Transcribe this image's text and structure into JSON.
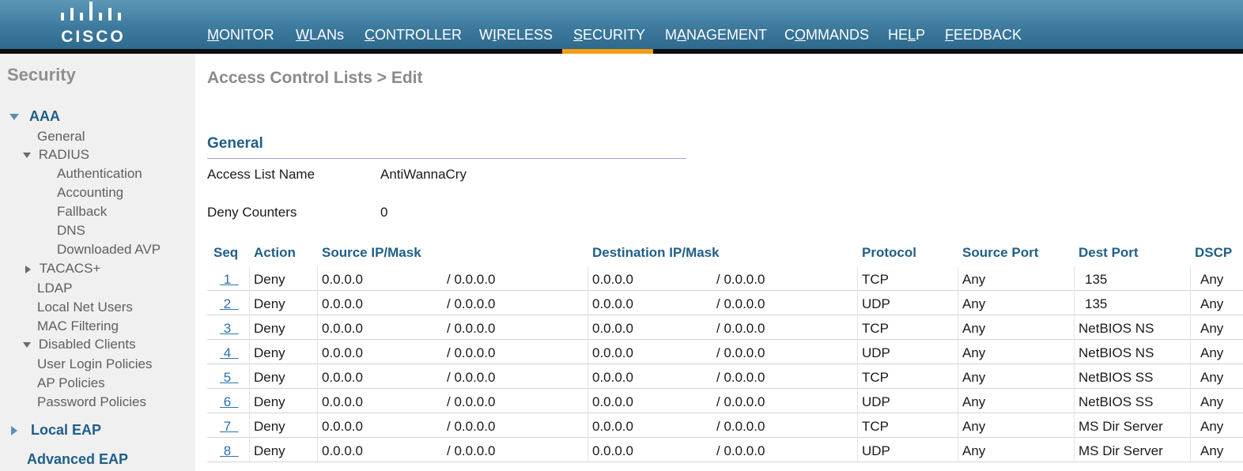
{
  "logo": {
    "text": "CISCO"
  },
  "nav": [
    {
      "label": "MONITOR",
      "u": "M",
      "rest": "ONITOR"
    },
    {
      "label": "WLANs",
      "u": "W",
      "rest": "LANs"
    },
    {
      "label": "CONTROLLER",
      "u": "C",
      "rest": "ONTROLLER"
    },
    {
      "label": "WIRELESS",
      "pre": "W",
      "u": "I",
      "rest": "RELESS"
    },
    {
      "label": "SECURITY",
      "u": "S",
      "rest": "ECURITY",
      "active": true
    },
    {
      "label": "MANAGEMENT",
      "pre": "M",
      "u": "A",
      "rest": "NAGEMENT"
    },
    {
      "label": "COMMANDS",
      "pre": "C",
      "u": "O",
      "rest": "MMANDS"
    },
    {
      "label": "HELP",
      "pre": "HE",
      "u": "L",
      "rest": "P"
    },
    {
      "label": "FEEDBACK",
      "u": "F",
      "rest": "EEDBACK"
    }
  ],
  "sidebar": {
    "title": "Security",
    "aaa": "AAA",
    "general": "General",
    "radius": "RADIUS",
    "authentication": "Authentication",
    "accounting": "Accounting",
    "fallback": "Fallback",
    "dns": "DNS",
    "downloaded_avp": "Downloaded AVP",
    "tacacs": "TACACS+",
    "ldap": "LDAP",
    "local_net_users": "Local Net Users",
    "mac_filtering": "MAC Filtering",
    "disabled_clients": "Disabled Clients",
    "user_login_policies": "User Login Policies",
    "ap_policies": "AP Policies",
    "password_policies": "Password Policies",
    "local_eap": "Local EAP",
    "advanced_eap": "Advanced EAP"
  },
  "page": {
    "title": "Access Control Lists > Edit",
    "section": "General",
    "access_list_name_label": "Access List Name",
    "access_list_name": "AntiWannaCry",
    "deny_counters_label": "Deny Counters",
    "deny_counters": "0"
  },
  "table": {
    "headers": {
      "seq": "Seq",
      "action": "Action",
      "source": "Source IP/Mask",
      "destination": "Destination IP/Mask",
      "protocol": "Protocol",
      "source_port": "Source Port",
      "dest_port": "Dest Port",
      "dscp": "DSCP"
    },
    "rows": [
      {
        "seq": "1",
        "action": "Deny",
        "src_ip": "0.0.0.0",
        "src_mask": "/ 0.0.0.0",
        "dst_ip": "0.0.0.0",
        "dst_mask": "/ 0.0.0.0",
        "protocol": "TCP",
        "src_port": "Any",
        "dst_port": "135",
        "dscp": "Any"
      },
      {
        "seq": "2",
        "action": "Deny",
        "src_ip": "0.0.0.0",
        "src_mask": "/ 0.0.0.0",
        "dst_ip": "0.0.0.0",
        "dst_mask": "/ 0.0.0.0",
        "protocol": "UDP",
        "src_port": "Any",
        "dst_port": "135",
        "dscp": "Any"
      },
      {
        "seq": "3",
        "action": "Deny",
        "src_ip": "0.0.0.0",
        "src_mask": "/ 0.0.0.0",
        "dst_ip": "0.0.0.0",
        "dst_mask": "/ 0.0.0.0",
        "protocol": "TCP",
        "src_port": "Any",
        "dst_port": "NetBIOS NS",
        "dscp": "Any"
      },
      {
        "seq": "4",
        "action": "Deny",
        "src_ip": "0.0.0.0",
        "src_mask": "/ 0.0.0.0",
        "dst_ip": "0.0.0.0",
        "dst_mask": "/ 0.0.0.0",
        "protocol": "UDP",
        "src_port": "Any",
        "dst_port": "NetBIOS NS",
        "dscp": "Any"
      },
      {
        "seq": "5",
        "action": "Deny",
        "src_ip": "0.0.0.0",
        "src_mask": "/ 0.0.0.0",
        "dst_ip": "0.0.0.0",
        "dst_mask": "/ 0.0.0.0",
        "protocol": "TCP",
        "src_port": "Any",
        "dst_port": "NetBIOS SS",
        "dscp": "Any"
      },
      {
        "seq": "6",
        "action": "Deny",
        "src_ip": "0.0.0.0",
        "src_mask": "/ 0.0.0.0",
        "dst_ip": "0.0.0.0",
        "dst_mask": "/ 0.0.0.0",
        "protocol": "UDP",
        "src_port": "Any",
        "dst_port": "NetBIOS SS",
        "dscp": "Any"
      },
      {
        "seq": "7",
        "action": "Deny",
        "src_ip": "0.0.0.0",
        "src_mask": "/ 0.0.0.0",
        "dst_ip": "0.0.0.0",
        "dst_mask": "/ 0.0.0.0",
        "protocol": "TCP",
        "src_port": "Any",
        "dst_port": "MS Dir Server",
        "dscp": "Any"
      },
      {
        "seq": "8",
        "action": "Deny",
        "src_ip": "0.0.0.0",
        "src_mask": "/ 0.0.0.0",
        "dst_ip": "0.0.0.0",
        "dst_mask": "/ 0.0.0.0",
        "protocol": "UDP",
        "src_port": "Any",
        "dst_port": "MS Dir Server",
        "dscp": "Any"
      }
    ]
  }
}
